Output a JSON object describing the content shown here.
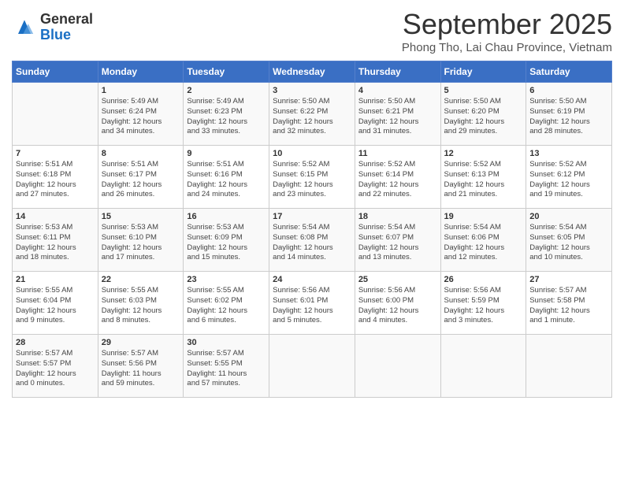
{
  "header": {
    "logo_general": "General",
    "logo_blue": "Blue",
    "month": "September 2025",
    "location": "Phong Tho, Lai Chau Province, Vietnam"
  },
  "days_of_week": [
    "Sunday",
    "Monday",
    "Tuesday",
    "Wednesday",
    "Thursday",
    "Friday",
    "Saturday"
  ],
  "weeks": [
    [
      {
        "day": "",
        "content": ""
      },
      {
        "day": "1",
        "content": "Sunrise: 5:49 AM\nSunset: 6:24 PM\nDaylight: 12 hours\nand 34 minutes."
      },
      {
        "day": "2",
        "content": "Sunrise: 5:49 AM\nSunset: 6:23 PM\nDaylight: 12 hours\nand 33 minutes."
      },
      {
        "day": "3",
        "content": "Sunrise: 5:50 AM\nSunset: 6:22 PM\nDaylight: 12 hours\nand 32 minutes."
      },
      {
        "day": "4",
        "content": "Sunrise: 5:50 AM\nSunset: 6:21 PM\nDaylight: 12 hours\nand 31 minutes."
      },
      {
        "day": "5",
        "content": "Sunrise: 5:50 AM\nSunset: 6:20 PM\nDaylight: 12 hours\nand 29 minutes."
      },
      {
        "day": "6",
        "content": "Sunrise: 5:50 AM\nSunset: 6:19 PM\nDaylight: 12 hours\nand 28 minutes."
      }
    ],
    [
      {
        "day": "7",
        "content": "Sunrise: 5:51 AM\nSunset: 6:18 PM\nDaylight: 12 hours\nand 27 minutes."
      },
      {
        "day": "8",
        "content": "Sunrise: 5:51 AM\nSunset: 6:17 PM\nDaylight: 12 hours\nand 26 minutes."
      },
      {
        "day": "9",
        "content": "Sunrise: 5:51 AM\nSunset: 6:16 PM\nDaylight: 12 hours\nand 24 minutes."
      },
      {
        "day": "10",
        "content": "Sunrise: 5:52 AM\nSunset: 6:15 PM\nDaylight: 12 hours\nand 23 minutes."
      },
      {
        "day": "11",
        "content": "Sunrise: 5:52 AM\nSunset: 6:14 PM\nDaylight: 12 hours\nand 22 minutes."
      },
      {
        "day": "12",
        "content": "Sunrise: 5:52 AM\nSunset: 6:13 PM\nDaylight: 12 hours\nand 21 minutes."
      },
      {
        "day": "13",
        "content": "Sunrise: 5:52 AM\nSunset: 6:12 PM\nDaylight: 12 hours\nand 19 minutes."
      }
    ],
    [
      {
        "day": "14",
        "content": "Sunrise: 5:53 AM\nSunset: 6:11 PM\nDaylight: 12 hours\nand 18 minutes."
      },
      {
        "day": "15",
        "content": "Sunrise: 5:53 AM\nSunset: 6:10 PM\nDaylight: 12 hours\nand 17 minutes."
      },
      {
        "day": "16",
        "content": "Sunrise: 5:53 AM\nSunset: 6:09 PM\nDaylight: 12 hours\nand 15 minutes."
      },
      {
        "day": "17",
        "content": "Sunrise: 5:54 AM\nSunset: 6:08 PM\nDaylight: 12 hours\nand 14 minutes."
      },
      {
        "day": "18",
        "content": "Sunrise: 5:54 AM\nSunset: 6:07 PM\nDaylight: 12 hours\nand 13 minutes."
      },
      {
        "day": "19",
        "content": "Sunrise: 5:54 AM\nSunset: 6:06 PM\nDaylight: 12 hours\nand 12 minutes."
      },
      {
        "day": "20",
        "content": "Sunrise: 5:54 AM\nSunset: 6:05 PM\nDaylight: 12 hours\nand 10 minutes."
      }
    ],
    [
      {
        "day": "21",
        "content": "Sunrise: 5:55 AM\nSunset: 6:04 PM\nDaylight: 12 hours\nand 9 minutes."
      },
      {
        "day": "22",
        "content": "Sunrise: 5:55 AM\nSunset: 6:03 PM\nDaylight: 12 hours\nand 8 minutes."
      },
      {
        "day": "23",
        "content": "Sunrise: 5:55 AM\nSunset: 6:02 PM\nDaylight: 12 hours\nand 6 minutes."
      },
      {
        "day": "24",
        "content": "Sunrise: 5:56 AM\nSunset: 6:01 PM\nDaylight: 12 hours\nand 5 minutes."
      },
      {
        "day": "25",
        "content": "Sunrise: 5:56 AM\nSunset: 6:00 PM\nDaylight: 12 hours\nand 4 minutes."
      },
      {
        "day": "26",
        "content": "Sunrise: 5:56 AM\nSunset: 5:59 PM\nDaylight: 12 hours\nand 3 minutes."
      },
      {
        "day": "27",
        "content": "Sunrise: 5:57 AM\nSunset: 5:58 PM\nDaylight: 12 hours\nand 1 minute."
      }
    ],
    [
      {
        "day": "28",
        "content": "Sunrise: 5:57 AM\nSunset: 5:57 PM\nDaylight: 12 hours\nand 0 minutes."
      },
      {
        "day": "29",
        "content": "Sunrise: 5:57 AM\nSunset: 5:56 PM\nDaylight: 11 hours\nand 59 minutes."
      },
      {
        "day": "30",
        "content": "Sunrise: 5:57 AM\nSunset: 5:55 PM\nDaylight: 11 hours\nand 57 minutes."
      },
      {
        "day": "",
        "content": ""
      },
      {
        "day": "",
        "content": ""
      },
      {
        "day": "",
        "content": ""
      },
      {
        "day": "",
        "content": ""
      }
    ]
  ]
}
